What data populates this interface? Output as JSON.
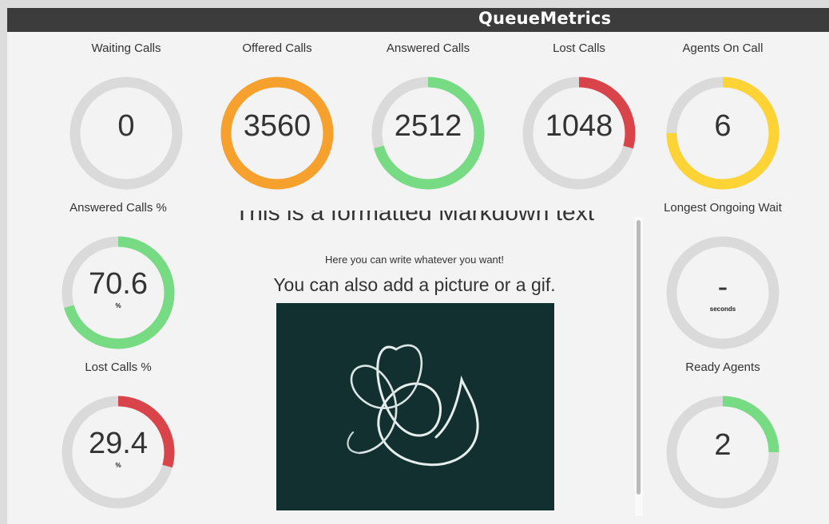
{
  "app": {
    "brand": "QueueMetrics"
  },
  "colors": {
    "track": "#dadada",
    "green": "#77db84",
    "orange": "#f6a02d",
    "red": "#d9434a",
    "yellow": "#fdd335"
  },
  "widgets": [
    {
      "id": "waiting",
      "title": "Waiting Calls",
      "value": "0",
      "unit": "",
      "color": "green",
      "fill": 0
    },
    {
      "id": "offered",
      "title": "Offered Calls",
      "value": "3560",
      "unit": "",
      "color": "orange",
      "fill": 1.0
    },
    {
      "id": "answered",
      "title": "Answered Calls",
      "value": "2512",
      "unit": "",
      "color": "green",
      "fill": 0.706
    },
    {
      "id": "lost",
      "title": "Lost Calls",
      "value": "1048",
      "unit": "",
      "color": "red",
      "fill": 0.294
    },
    {
      "id": "agents-on-call",
      "title": "Agents On Call",
      "value": "6",
      "unit": "",
      "color": "yellow",
      "fill": 0.75
    },
    {
      "id": "answered-pct",
      "title": "Answered Calls %",
      "value": "70.6",
      "unit": "%",
      "color": "green",
      "fill": 0.706
    },
    {
      "id": "longest-wait",
      "title": "Longest Ongoing Wait",
      "value": "-",
      "unit": "seconds",
      "color": "green",
      "fill": 0
    },
    {
      "id": "lost-pct",
      "title": "Lost Calls %",
      "value": "29.4",
      "unit": "%",
      "color": "red",
      "fill": 0.294
    },
    {
      "id": "ready-agents",
      "title": "Ready Agents",
      "value": "2",
      "unit": "",
      "color": "green",
      "fill": 0.25
    }
  ],
  "markdown": {
    "heading": "This is a formatted Markdown text",
    "paragraph": "Here you can write whatever you want!",
    "subheading": "You can also add a picture or a gif."
  }
}
